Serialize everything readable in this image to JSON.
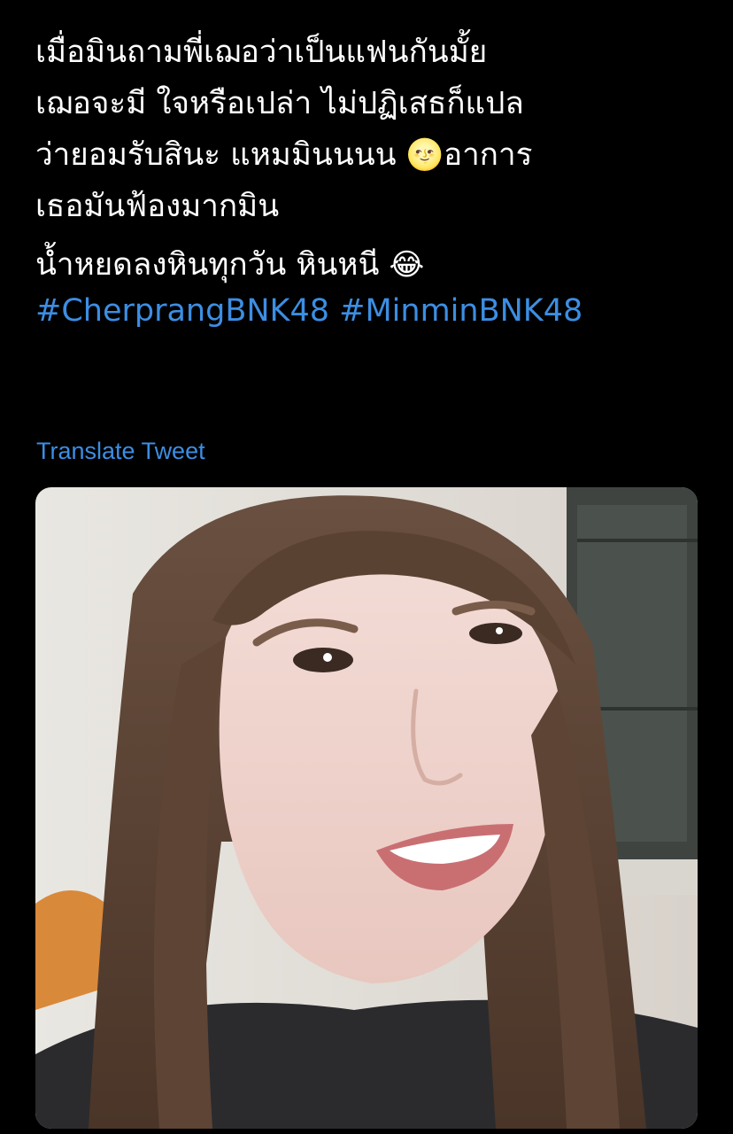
{
  "tweet": {
    "lines": [
      "เมื่อมินถามพี่เฌอว่าเป็นแฟนกันมั้ย",
      "เฌอจะมี ใจหรือเปล่า ไม่ปฏิเสธก็แปล",
      "ว่ายอมรับสินะ แหมมินนนน",
      "อาการ",
      "เธอมันฟ้องมากมิน"
    ],
    "line2_prefix": "น้ำหยดลงหินทุกวัน หินหนี",
    "emoji_moon": "🌝",
    "emoji_laugh": "😂",
    "hashtags": [
      "#CherprangBNK48",
      "#MinminBNK48"
    ]
  },
  "translate_label": "Translate Tweet",
  "media": {
    "icon": "video-frame-person"
  },
  "colors": {
    "background": "#000000",
    "text": "#ffffff",
    "link": "#3c8ee3"
  }
}
